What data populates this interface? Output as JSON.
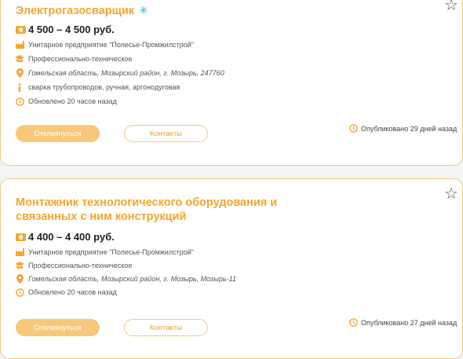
{
  "vacancies": [
    {
      "title": "Электрогазосварщик",
      "badge_icon": "snowflake-icon",
      "salary": "4 500 – 4 500 руб.",
      "employer": "Унитарное предприятие \"Полесье-Промжилстрой\"",
      "education": "Профессионально-техническое",
      "location": "Гомельская область, Мозырский район, г. Мозырь, 247760",
      "details": "сварка трубопроводов, ручная, аргонодуговая",
      "updated": "Обновлено 20 часов назад",
      "apply_label": "Откликнуться",
      "contacts_label": "Контакты",
      "published": "Опубликовано 29 дней назад"
    },
    {
      "title": "Монтажник технологического оборудования и связанных с ним конструкций",
      "salary": "4 400 – 4 400 руб.",
      "employer": "Унитарное предприятие \"Полесье-Промжилстрой\"",
      "education": "Профессионально-техническое",
      "location": "Гомельская область, Мозырский район, г. Мозырь, Мозырь-11",
      "updated": "Обновлено 20 часов назад",
      "apply_label": "Откликнуться",
      "contacts_label": "Контакты",
      "published": "Опубликовано 27 дней назад"
    }
  ],
  "colors": {
    "accent": "#f6a52d",
    "button_fill": "#f8c87a",
    "card_border": "#f0c987",
    "badge": "#21b2e4"
  }
}
